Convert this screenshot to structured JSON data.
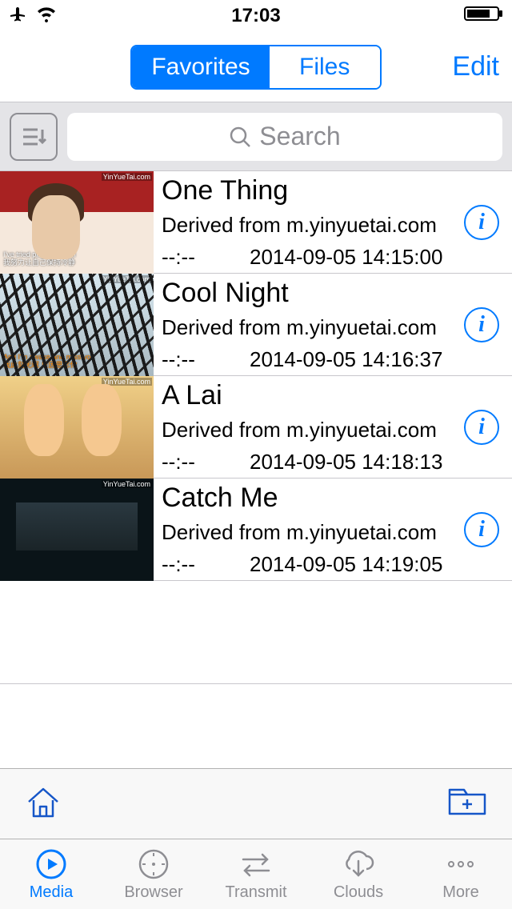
{
  "status": {
    "time": "17:03"
  },
  "nav": {
    "segments": [
      "Favorites",
      "Files"
    ],
    "active": 0,
    "edit": "Edit"
  },
  "search": {
    "placeholder": "Search"
  },
  "items": [
    {
      "title": "One Thing",
      "source": "Derived from m.yinyuetai.com",
      "duration": "--:--",
      "date": "2014-09-05 14:15:00"
    },
    {
      "title": "Cool Night",
      "source": "Derived from m.yinyuetai.com",
      "duration": "--:--",
      "date": "2014-09-05 14:16:37"
    },
    {
      "title": "A Lai",
      "source": "Derived from m.yinyuetai.com",
      "duration": "--:--",
      "date": "2014-09-05 14:18:13"
    },
    {
      "title": "Catch Me",
      "source": "Derived from m.yinyuetai.com",
      "duration": "--:--",
      "date": "2014-09-05 14:19:05"
    }
  ],
  "tabs": [
    {
      "label": "Media"
    },
    {
      "label": "Browser"
    },
    {
      "label": "Transmit"
    },
    {
      "label": "Clouds"
    },
    {
      "label": "More"
    }
  ],
  "colors": {
    "accent": "#007aff",
    "gray": "#8e8e93"
  }
}
